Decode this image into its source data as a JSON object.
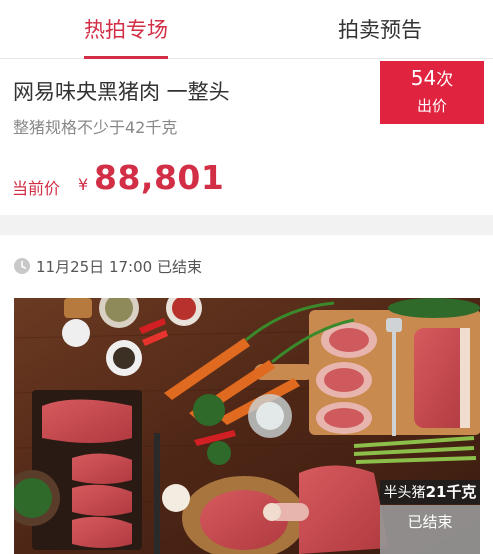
{
  "tabs": [
    {
      "label": "热拍专场",
      "active": true
    },
    {
      "label": "拍卖预告",
      "active": false
    }
  ],
  "auction": {
    "title": "网易味央黑猪肉 一整头",
    "spec": "整猪规格不少于42千克",
    "price_label": "当前价",
    "currency": "¥",
    "price": "88,801",
    "bid_count": "54",
    "bid_count_unit": "次",
    "bid_label": "出价"
  },
  "next_auction": {
    "end_time": "11月25日 17:00 已结束",
    "image_label_prefix": "半头猪",
    "image_label_weight": "21千克",
    "status": "已结束"
  },
  "colors": {
    "accent": "#d22f46",
    "badge": "#e0233f",
    "separator": "#f2f2f2"
  },
  "icons": {
    "clock": "clock-icon"
  }
}
